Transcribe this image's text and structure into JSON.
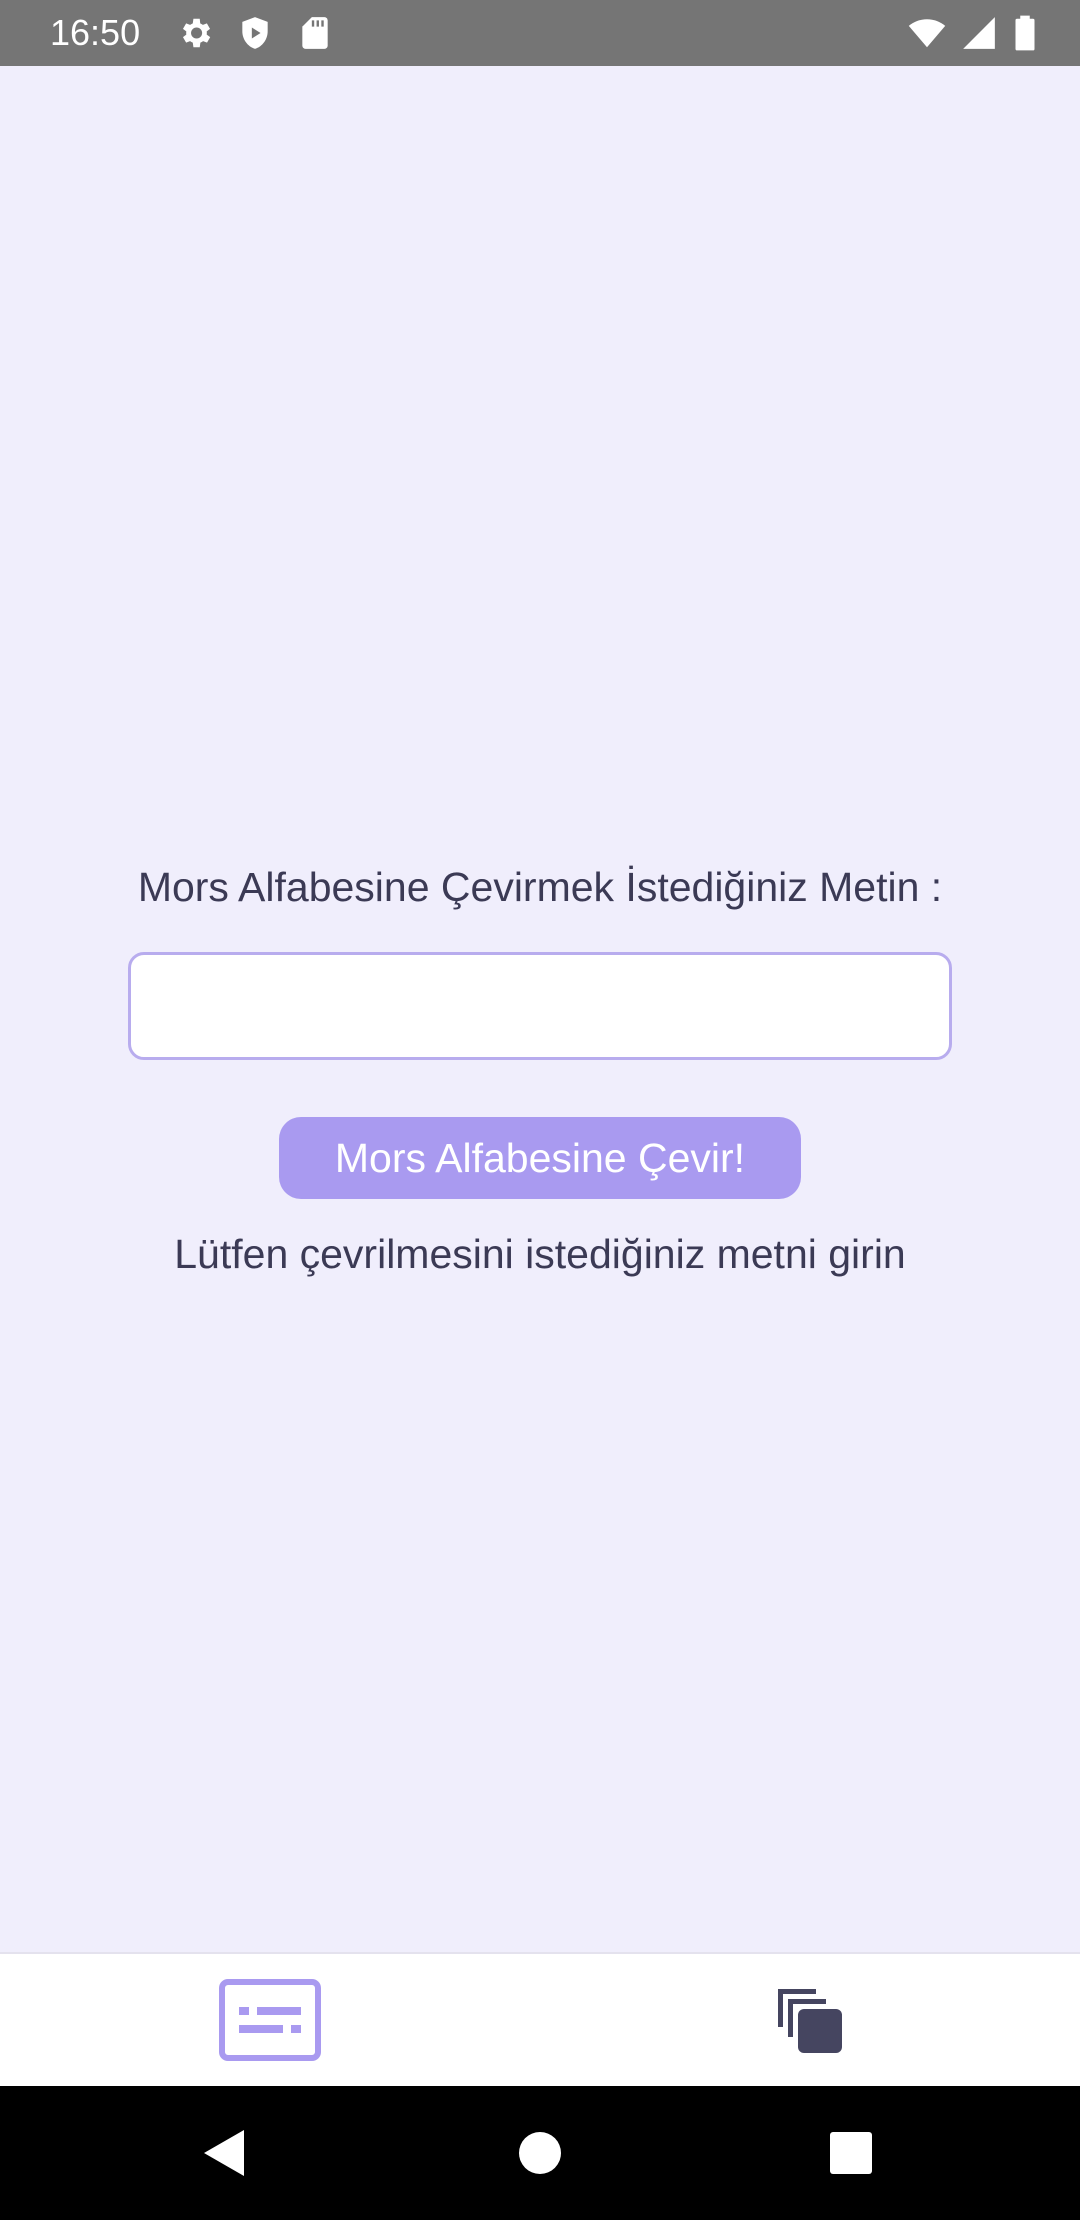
{
  "status_bar": {
    "time": "16:50",
    "icons_left": [
      "settings-icon",
      "shield-icon",
      "sd-card-icon"
    ],
    "icons_right": [
      "wifi-icon",
      "signal-icon",
      "battery-icon"
    ]
  },
  "main": {
    "prompt_label": "Mors Alfabesine Çevirmek İstediğiniz Metin :",
    "input": {
      "value": "",
      "placeholder": ""
    },
    "convert_button_label": "Mors Alfabesine Çevir!",
    "result_text": "Lütfen çevrilmesini istediğiniz metni girin"
  },
  "bottom_nav": {
    "items": [
      {
        "icon": "translate-text-icon",
        "active": true
      },
      {
        "icon": "copy-icon",
        "active": false
      }
    ]
  },
  "system_nav": {
    "buttons": [
      "back-icon",
      "home-icon",
      "recents-icon"
    ]
  },
  "colors": {
    "accent": "#a99af0",
    "background": "#f0eefc",
    "status_bar": "#757575",
    "text": "#3b3a55",
    "inactive_icon": "#454560"
  }
}
